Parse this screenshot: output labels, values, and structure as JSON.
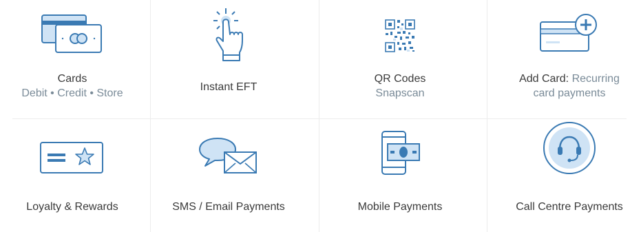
{
  "colors": {
    "icon_stroke": "#3a7ab3",
    "icon_fill": "#cfe3f5",
    "text": "#3a3a3a",
    "subtext": "#7a8b98",
    "divider": "#ececec"
  },
  "tiles": [
    {
      "icon": "cards-icon",
      "label": "Cards",
      "sub": "Debit • Credit • Store"
    },
    {
      "icon": "tap-hand-icon",
      "label": "Instant EFT",
      "sub": ""
    },
    {
      "icon": "qr-code-icon",
      "label": "QR Codes",
      "sub": "Snapscan"
    },
    {
      "icon": "add-card-icon",
      "label": "Add Card:",
      "inline_sub": "Recurring",
      "sub": "card payments"
    },
    {
      "icon": "loyalty-card-icon",
      "label": "Loyalty & Rewards",
      "sub": ""
    },
    {
      "icon": "sms-email-icon",
      "label": "SMS / Email Payments",
      "sub": ""
    },
    {
      "icon": "mobile-payment-icon",
      "label": "Mobile Payments",
      "sub": ""
    },
    {
      "icon": "headset-icon",
      "label": "Call Centre Payments",
      "sub": ""
    }
  ]
}
